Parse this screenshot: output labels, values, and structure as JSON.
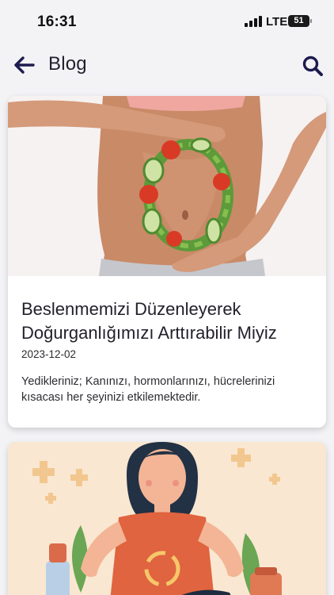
{
  "status_bar": {
    "time": "16:31",
    "network": "LTE",
    "battery": "51"
  },
  "header": {
    "title": "Blog"
  },
  "posts": [
    {
      "title": "Beslenmemizi Düzenleyerek Doğurganlığımızı Arttırabilir Miyiz",
      "date": "2023-12-02",
      "excerpt": "Yedikleriniz; Kanınızı, hormonlarınızı, hücrelerinizi kısacası her şeyinizi etkilemektedir."
    },
    {}
  ],
  "icons": {
    "back": "arrow-left-icon",
    "search": "search-icon",
    "signal": "signal-icon",
    "battery": "battery-icon"
  },
  "colors": {
    "accent": "#1e1b4f",
    "background": "#f3f3f6",
    "card": "#ffffff"
  }
}
